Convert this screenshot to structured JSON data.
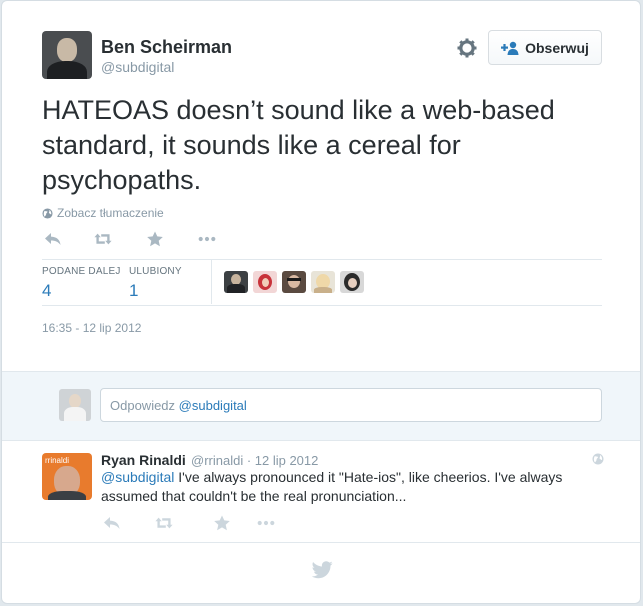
{
  "tweet": {
    "author_name": "Ben Scheirman",
    "author_handle": "@subdigital",
    "follow_label": "Obserwuj",
    "text": "HATEOAS doesn’t sound like a web-based standard, it sounds like a cereal for psychopaths.",
    "translate_label": "Zobacz tłumaczenie",
    "stats": {
      "retweets_label": "PODANE DALEJ",
      "retweets_count": "4",
      "favorites_label": "ULUBIONY",
      "favorites_count": "1"
    },
    "timestamp": "16:35 - 12 lip 2012"
  },
  "reply_box": {
    "prefix": "Odpowiedz",
    "mention": "@subdigital"
  },
  "reply_tweet": {
    "author_name": "Ryan Rinaldi",
    "meta": "@rrinaldi · 12 lip 2012",
    "avatar_tag": "rrinaldi",
    "mention": "@subdigital",
    "text": " I've always pronounced it \"Hate-ios\", like cheerios. I've always assumed that couldn't be the real pronunciation..."
  },
  "icons": {
    "settings": "gear-icon",
    "follow": "add-user-icon",
    "translate": "globe-icon",
    "reply": "reply-icon",
    "retweet": "retweet-icon",
    "favorite": "star-icon",
    "more": "more-icon",
    "footer": "twitter-bird-icon"
  },
  "colors": {
    "link": "#2b7bb9",
    "muted": "#8899a6",
    "text": "#292f33",
    "reply_bg": "#f0f6fa"
  }
}
